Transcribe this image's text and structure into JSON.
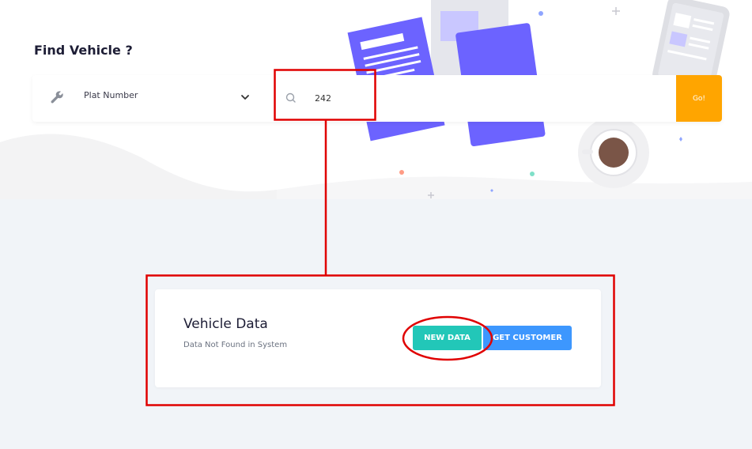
{
  "header": {
    "title": "Find Vehicle ?"
  },
  "search": {
    "filter_icon": "wrench-icon",
    "filter_label": "Plat Number",
    "search_icon": "search-icon",
    "value": "242",
    "go_label": "Go!"
  },
  "result": {
    "title": "Vehicle Data",
    "message": "Data Not Found in System",
    "new_data_label": "NEW DATA",
    "get_customer_label": "GET CUSTOMER"
  },
  "colors": {
    "go": "#ffa500",
    "new_data": "#22c7b8",
    "get_customer": "#3d97fe",
    "annotation": "#e00000",
    "illustration": "#6c63ff"
  }
}
